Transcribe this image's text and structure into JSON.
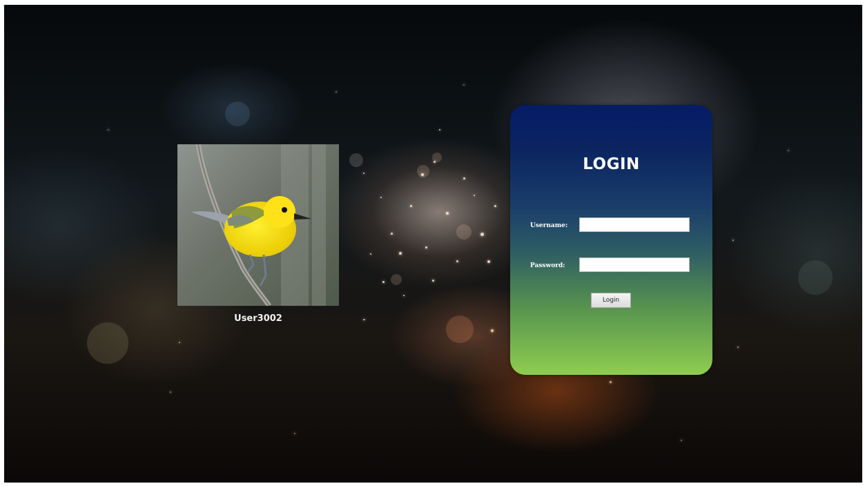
{
  "user": {
    "display_name": "User3002",
    "avatar_icon": "yellow-warbler-bird-photo"
  },
  "login": {
    "title": "LOGIN",
    "username_label": "Username:",
    "password_label": "Password:",
    "username_value": "",
    "password_value": "",
    "button_label": "Login"
  },
  "colors": {
    "card_top": "#051c66",
    "card_bottom": "#8fcd50",
    "background": "#0b0f12"
  }
}
